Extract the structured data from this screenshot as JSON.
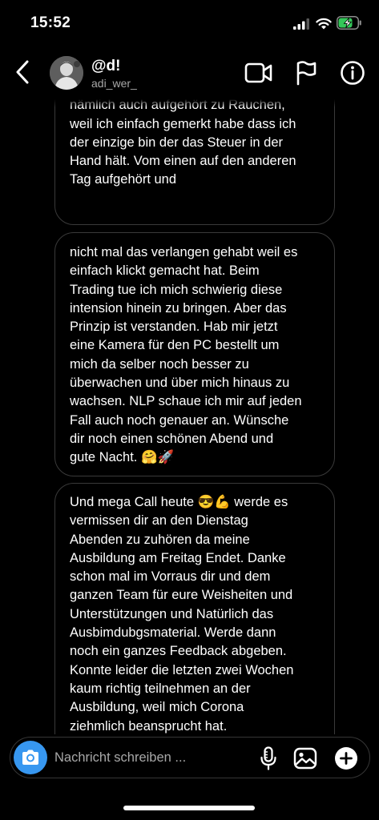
{
  "status_bar": {
    "time": "15:52",
    "icons": [
      "signal-icon",
      "wifi-icon",
      "battery-charging-icon"
    ]
  },
  "header": {
    "name": "@d!",
    "username": "adi_wer_",
    "icons": [
      "back-chevron-icon",
      "video-camera-icon",
      "flag-icon",
      "info-icon"
    ]
  },
  "messages": [
    {
      "text": "Dank dir und dem Trading habe ich\nnämlich auch aufgehört zu Rauchen,\nweil ich einfach gemerkt habe dass ich\nder einzige bin der das Steuer in der\nHand hält. Vom einen auf den anderen\nTag aufgehört und"
    },
    {
      "text": "nicht mal das verlangen gehabt weil es\neinfach klickt gemacht hat. Beim\nTrading tue ich mich schwierig diese\nintension hinein zu bringen. Aber das\nPrinzip ist verstanden. Hab mir jetzt\neine Kamera für den PC bestellt um\nmich da selber noch besser zu\nüberwachen und über mich hinaus zu\nwachsen. NLP schaue ich mir auf jeden\nFall auch noch genauer an. Wünsche\ndir noch einen schönen Abend und\ngute Nacht. 🤗🚀"
    },
    {
      "text": "Und mega Call heute 😎💪 werde es\nvermissen dir an den Dienstag\nAbenden zu zuhören da meine\nAusbildung am Freitag Endet. Danke\nschon mal im Vorraus dir und dem\nganzen Team für eure Weisheiten und\nUnterstützungen und Natürlich das\nAusbimdubgsmaterial. Werde dann\nnoch ein ganzes Feedback abgeben.\nKonnte leider die letzten zwei Wochen\nkaum richtig teilnehmen an der\nAusbildung, weil mich Corona\nziehmlich beansprucht hat."
    }
  ],
  "composer": {
    "placeholder": "Nachricht schreiben ...",
    "value": "",
    "icons": [
      "camera-icon",
      "microphone-icon",
      "gallery-icon",
      "plus-icon"
    ],
    "camera_color": "#3797f0"
  },
  "colors": {
    "background": "#000000",
    "bubble_border": "#3a3a3a",
    "secondary_text": "#a8a8a8",
    "battery_fill": "#34c759"
  }
}
